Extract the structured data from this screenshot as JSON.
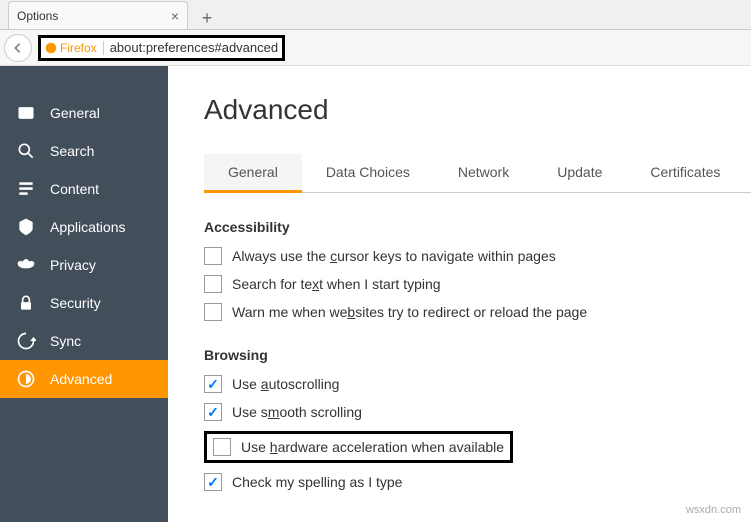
{
  "tab": {
    "title": "Options"
  },
  "urlbar": {
    "badge": "Firefox",
    "url": "about:preferences#advanced"
  },
  "sidebar": {
    "items": [
      {
        "label": "General"
      },
      {
        "label": "Search"
      },
      {
        "label": "Content"
      },
      {
        "label": "Applications"
      },
      {
        "label": "Privacy"
      },
      {
        "label": "Security"
      },
      {
        "label": "Sync"
      },
      {
        "label": "Advanced"
      }
    ]
  },
  "page": {
    "heading": "Advanced",
    "tabs": [
      {
        "label": "General"
      },
      {
        "label": "Data Choices"
      },
      {
        "label": "Network"
      },
      {
        "label": "Update"
      },
      {
        "label": "Certificates"
      }
    ],
    "sections": {
      "accessibility": {
        "title": "Accessibility",
        "opt1_pre": "Always use the ",
        "opt1_u": "c",
        "opt1_post": "ursor keys to navigate within pages",
        "opt2_pre": "Search for te",
        "opt2_u": "x",
        "opt2_post": "t when I start typing",
        "opt3_pre": "Warn me when we",
        "opt3_u": "b",
        "opt3_post": "sites try to redirect or reload the page"
      },
      "browsing": {
        "title": "Browsing",
        "opt1_pre": "Use ",
        "opt1_u": "a",
        "opt1_post": "utoscrolling",
        "opt2_pre": "Use s",
        "opt2_u": "m",
        "opt2_post": "ooth scrolling",
        "opt3_pre": "Use ",
        "opt3_u": "h",
        "opt3_post": "ardware acceleration when available",
        "opt4_pre": "Check my spellin",
        "opt4_u": "g",
        "opt4_post": " as I type"
      }
    }
  },
  "watermark": "wsxdn.com"
}
